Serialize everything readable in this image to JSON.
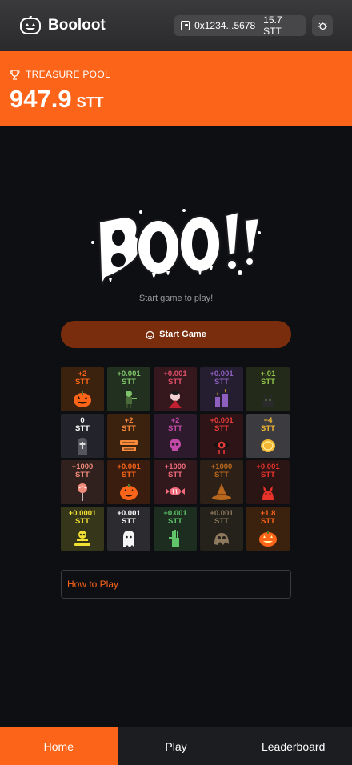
{
  "header": {
    "app_name": "Booloot",
    "wallet_address": "0x1234...5678",
    "wallet_balance": "15.7 STT",
    "logo_icon": "pumpkin-icon",
    "settings_icon": "theme-toggle-icon"
  },
  "treasure": {
    "label": "TREASURE POOL",
    "amount": "947.9",
    "unit": "STT",
    "icon": "trophy-icon"
  },
  "main": {
    "logo_text": "BOO!!",
    "subtitle": "Start game to play!",
    "start_label": "Start Game"
  },
  "grid": [
    {
      "value": "+2",
      "unit": "STT",
      "icon": "pumpkin-icon",
      "color": "#fb6419",
      "bg": "#3a220e"
    },
    {
      "value": "+0.001",
      "unit": "STT",
      "icon": "zombie-icon",
      "color": "#7ec46a",
      "bg": "#22301f"
    },
    {
      "value": "+0.001",
      "unit": "STT",
      "icon": "vampire-icon",
      "color": "#e0506a",
      "bg": "#34181e"
    },
    {
      "value": "+0.001",
      "unit": "STT",
      "icon": "candles-icon",
      "color": "#8e5fbf",
      "bg": "#251d30"
    },
    {
      "value": "+.01",
      "unit": "STT",
      "icon": "black-cat-icon",
      "color": "#8fc24a",
      "bg": "#232a1a"
    },
    {
      "value": "0",
      "unit": "STT",
      "icon": "tombstone-icon",
      "color": "#ffffff",
      "bg": "#23232b"
    },
    {
      "value": "+2",
      "unit": "STT",
      "icon": "happy-halloween-icon",
      "color": "#fb8a3a",
      "bg": "#3a220e"
    },
    {
      "value": "+2",
      "unit": "STT",
      "icon": "skull-icon",
      "color": "#c34aa8",
      "bg": "#2e1a2d"
    },
    {
      "value": "+0.001",
      "unit": "STT",
      "icon": "eyeball-icon",
      "color": "#e83a3a",
      "bg": "#2e1416"
    },
    {
      "value": "+4",
      "unit": "STT",
      "icon": "coin-icon",
      "color": "#f2b632",
      "bg": "#3c3c40"
    },
    {
      "value": "+1000",
      "unit": "STT",
      "icon": "lollipop-icon",
      "color": "#f08a7a",
      "bg": "#30201e"
    },
    {
      "value": "+0.001",
      "unit": "STT",
      "icon": "pumpkin-icon",
      "color": "#fb6419",
      "bg": "#3a1d0e"
    },
    {
      "value": "+1000",
      "unit": "STT",
      "icon": "candy-icon",
      "color": "#f06a7a",
      "bg": "#30181c"
    },
    {
      "value": "+1000",
      "unit": "STT",
      "icon": "witch-hat-icon",
      "color": "#b8681e",
      "bg": "#2d2016"
    },
    {
      "value": "+0.001",
      "unit": "STT",
      "icon": "devil-cat-icon",
      "color": "#e8322a",
      "bg": "#2b1414"
    },
    {
      "value": "+0.0001",
      "unit": "STT",
      "icon": "skeleton-icon",
      "color": "#f2e032",
      "bg": "#36361a"
    },
    {
      "value": "+0.001",
      "unit": "STT",
      "icon": "ghost-icon",
      "color": "#ffffff",
      "bg": "#2c2c30"
    },
    {
      "value": "+0.001",
      "unit": "STT",
      "icon": "zombie-hand-icon",
      "color": "#5fc46a",
      "bg": "#1d2d20"
    },
    {
      "value": "+0.001",
      "unit": "STT",
      "icon": "owl-ghost-icon",
      "color": "#8e7a5e",
      "bg": "#25211b"
    },
    {
      "value": "+1.8",
      "unit": "STT",
      "icon": "jack-o-lantern-icon",
      "color": "#fb6419",
      "bg": "#3a220e"
    }
  ],
  "how_to_play": "How to Play",
  "nav": [
    {
      "label": "Home",
      "active": true
    },
    {
      "label": "Play",
      "active": false
    },
    {
      "label": "Leaderboard",
      "active": false
    }
  ]
}
